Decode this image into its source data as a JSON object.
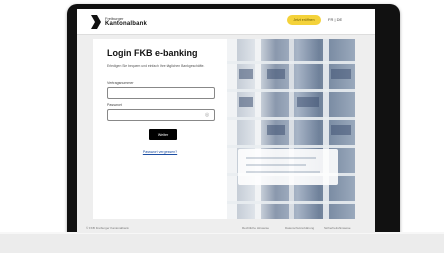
{
  "brand": {
    "line1": "Freiburger",
    "line2": "Kantonalbank"
  },
  "header": {
    "pill_label": "Jetzt eröffnen",
    "language": "FR | DE"
  },
  "login": {
    "title": "Login FKB e-banking",
    "description": "Erledigen Sie bequem und einfach Ihre täglichen Bankgeschäfte.",
    "contract_label": "Vertragsnummer",
    "contract_value": "",
    "password_label": "Passwort",
    "password_value": "",
    "submit_label": "Weiter",
    "forgot_label": "Passwort vergessen?"
  },
  "footer": {
    "copyright": "© FKB Freiburger Kantonalbank",
    "links": [
      "Rechtliche Hinweise",
      "Datenschutzerklärung",
      "Sicherheitshinweise"
    ]
  },
  "colors": {
    "accent_pill": "#f4d23a",
    "button": "#000000",
    "link": "#1d4fa3"
  }
}
